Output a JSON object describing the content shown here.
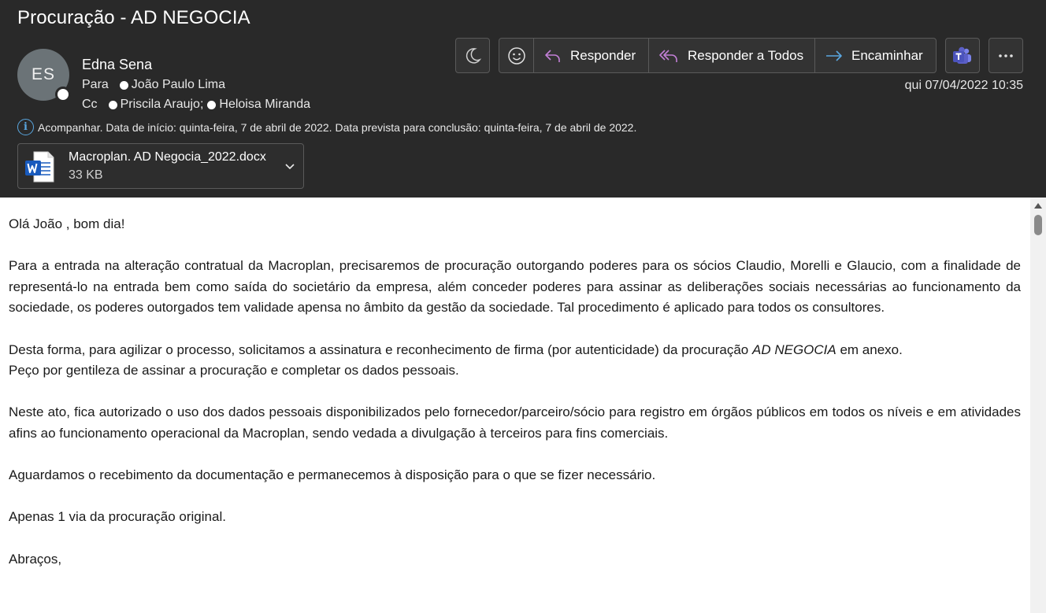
{
  "email": {
    "subject": "Procuração - AD NEGOCIA",
    "avatar_initials": "ES",
    "sender": "Edna Sena",
    "to_label": "Para",
    "to": [
      "João Paulo Lima"
    ],
    "cc_label": "Cc",
    "cc": [
      "Priscila Araujo;",
      "Heloisa Miranda"
    ],
    "date": "qui 07/04/2022 10:35",
    "info": "Acompanhar.  Data de início: quinta-feira, 7 de abril de 2022.  Data prevista para conclusão: quinta-feira, 7 de abril de 2022."
  },
  "attachment": {
    "name": "Macroplan. AD Negocia_2022.docx",
    "size": "33 KB",
    "icon": "word-file-icon"
  },
  "toolbar": {
    "reply": "Responder",
    "reply_all": "Responder a Todos",
    "forward": "Encaminhar",
    "icons": [
      "moon-icon",
      "emoji-icon",
      "reply-icon",
      "reply-all-icon",
      "forward-icon",
      "teams-icon",
      "more-icon"
    ]
  },
  "body": {
    "p1": "Olá João ,  bom dia!",
    "p2": "Para a entrada na alteração contratual da Macroplan, precisaremos de procuração outorgando poderes para os sócios Claudio, Morelli e Glaucio, com a finalidade de representá-lo na entrada bem como saída do societário da empresa, além conceder poderes para assinar as deliberações sociais necessárias ao funcionamento da sociedade, os poderes outorgados tem validade apensa no âmbito da gestão da sociedade. Tal procedimento é aplicado para todos os consultores.",
    "p3a": "Desta forma, para agilizar o processo, solicitamos a assinatura e reconhecimento de firma (por autenticidade) da procuração ",
    "p3_italic": "AD NEGOCIA",
    "p3b": " em anexo.",
    "p3c": "Peço por gentileza de assinar a procuração e completar os dados pessoais.",
    "p4": "Neste ato, fica autorizado o uso dos dados pessoais disponibilizados pelo fornecedor/parceiro/sócio para registro em órgãos públicos em todos os níveis e em atividades afins ao funcionamento operacional da Macroplan, sendo vedada a divulgação à terceiros para fins comerciais.",
    "p5": "Aguardamos o recebimento da documentação e permanecemos à disposição para o que se fizer necessário.",
    "p6": "Apenas 1 via da procuração original.",
    "p7": "Abraços,"
  },
  "colors": {
    "header_bg": "#292929",
    "reply_accent": "#c27fd6",
    "forward_accent": "#5aa7e0",
    "word_blue": "#185abd",
    "teams_purple": "#5b5fc7"
  }
}
